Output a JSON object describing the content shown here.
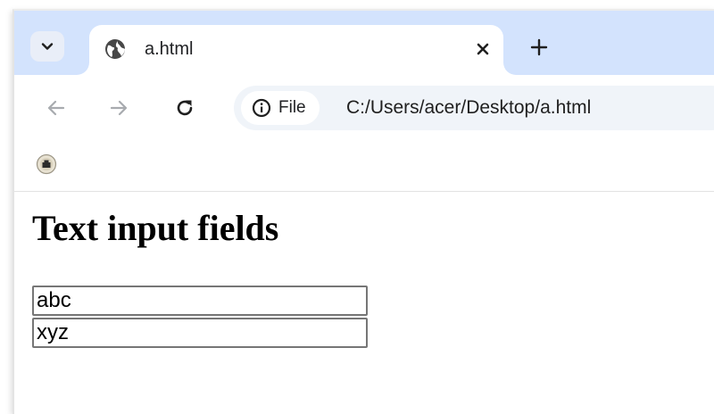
{
  "browser": {
    "tab": {
      "title": "a.html"
    },
    "omnibox": {
      "chip_label": "File",
      "url": "C:/Users/acer/Desktop/a.html"
    }
  },
  "page": {
    "heading": "Text input fields",
    "inputs": [
      {
        "value": "abc"
      },
      {
        "value": "xyz"
      }
    ]
  }
}
